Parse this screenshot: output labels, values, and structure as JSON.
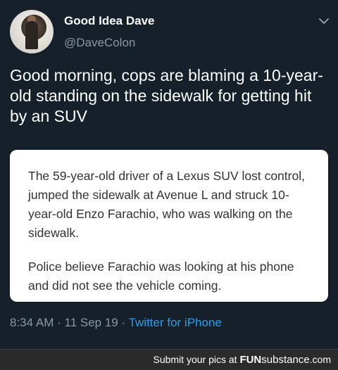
{
  "tweet": {
    "author_name": "Good Idea Dave",
    "author_handle": "@DaveColon",
    "text": "Good morning, cops are blaming a 10-year-old standing on the sidewalk for getting hit by an SUV",
    "card": {
      "paragraph_1": "The 59-year-old driver of a Lexus SUV lost control, jumped the sidewalk at Avenue L and struck 10-year-old Enzo Farachio, who was walking on the sidewalk.",
      "paragraph_2": "Police believe Farachio was looking at his phone and did not see the vehicle coming."
    },
    "time": "8:34 AM",
    "date": "11 Sep 19",
    "source": "Twitter for iPhone"
  },
  "footer": {
    "submit_text": "Submit your pics at",
    "brand_fun": "FUN",
    "brand_substance": "substance",
    "brand_tld": ".com"
  },
  "colors": {
    "background": "#15202b",
    "link": "#1da1f2",
    "secondary_text": "#8899a6"
  },
  "icons": [
    "avatar",
    "chevron-down-icon"
  ]
}
